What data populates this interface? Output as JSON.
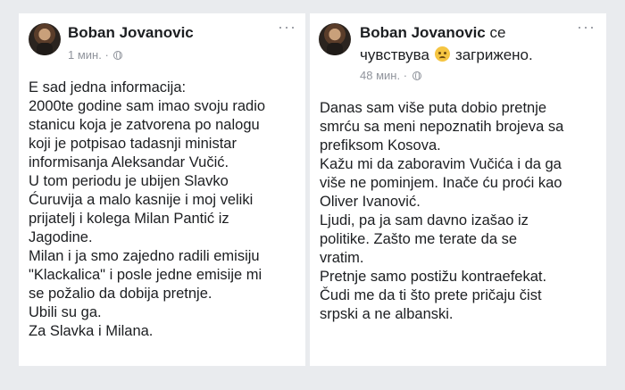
{
  "left_post": {
    "author": "Boban Jovanovic",
    "timestamp": "1 мин.",
    "separator": "·",
    "more": "···",
    "lines": [
      "E sad jedna informacija:",
      "2000te godine sam imao svoju radio",
      "stanicu koja je zatvorena po nalogu",
      "koji je potpisao tadasnji ministar",
      "informisanja Aleksandar Vučić.",
      "U tom periodu je ubijen Slavko",
      "Ćuruvija a malo kasnije i moj veliki",
      "prijatelj i kolega Milan Pantić iz",
      "Jagodine.",
      "Milan i ja smo zajedno radili emisiju",
      "\"Klackalica\" i posle jedne emisije mi",
      "se požalio da dobija pretnje.",
      "Ubili su ga.",
      "Za Slavka i Milana."
    ]
  },
  "right_post": {
    "author": "Boban Jovanovic",
    "feeling_prefix": "се",
    "feeling_verb": "чувствува",
    "feeling_word": "загрижено.",
    "timestamp": "48 мин.",
    "separator": "·",
    "more": "···",
    "lines": [
      "Danas sam više puta dobio pretnje",
      "smrću sa meni nepoznatih brojeva sa",
      "prefiksom Kosova.",
      "Kažu mi da zaboravim Vučića i da ga",
      "više ne pominjem. Inače ću proći kao",
      "Oliver Ivanović.",
      "Ljudi, pa ja sam davno izašao iz",
      "politike. Zašto me terate da se",
      "vratim.",
      "Pretnje samo postižu kontraefekat.",
      "Čudi me da ti što prete pričaju čist",
      "srpski a ne albanski."
    ]
  },
  "icons": {
    "avatar": "profile-photo",
    "more": "more-options-icon",
    "privacy": "globe-icon",
    "feeling": "worried-face-emoji"
  }
}
